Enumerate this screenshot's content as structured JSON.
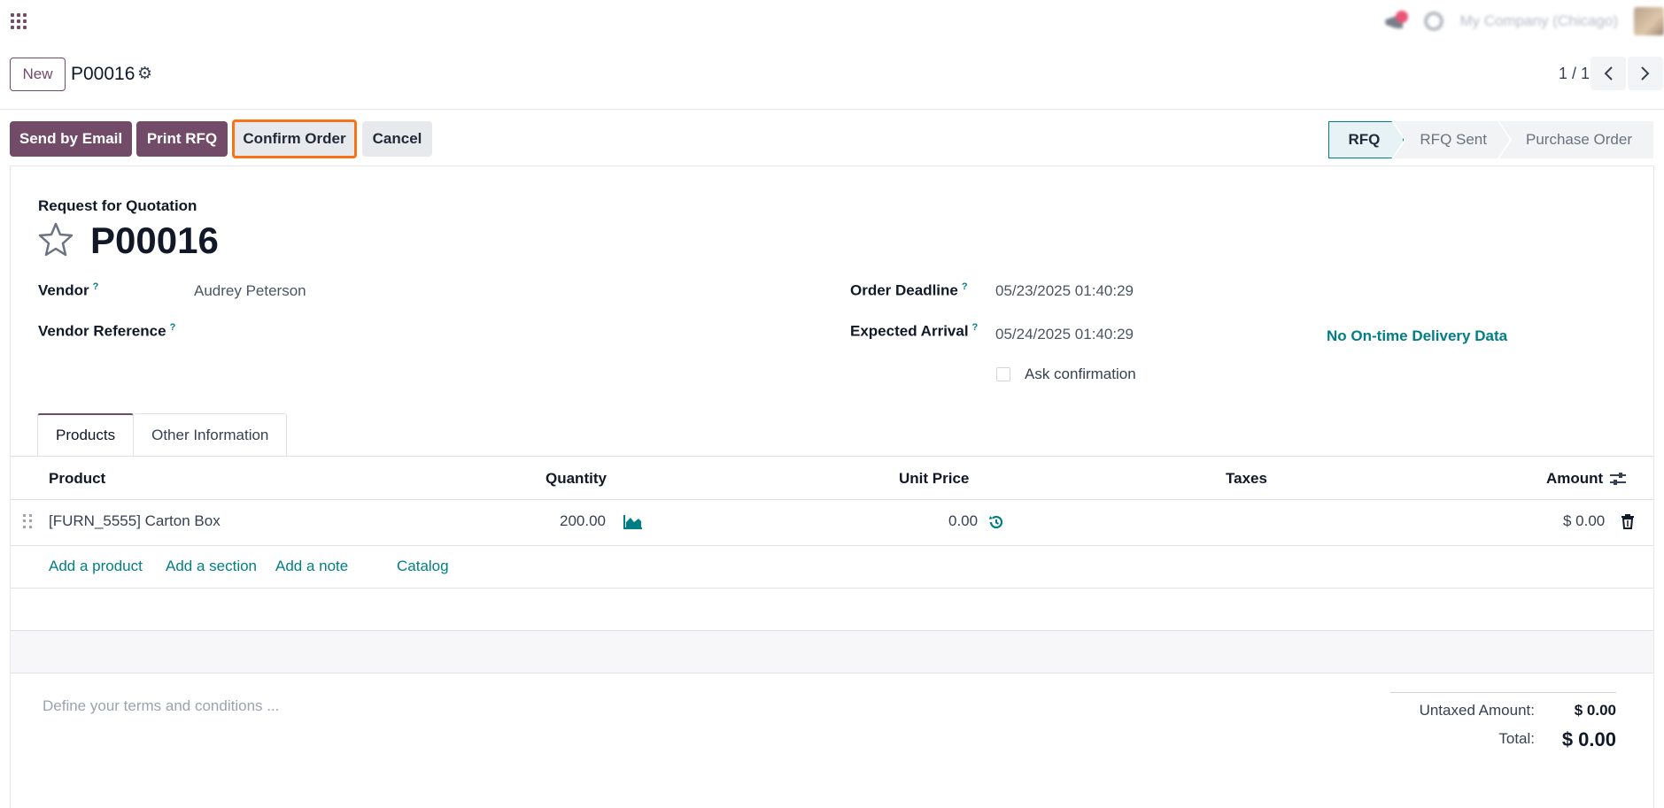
{
  "navbar": {
    "company": "My Company (Chicago)"
  },
  "control": {
    "new_label": "New",
    "record_name": "P00016",
    "pager": "1 / 1"
  },
  "actions": {
    "send_email": "Send by Email",
    "print_rfq": "Print RFQ",
    "confirm_order": "Confirm Order",
    "cancel": "Cancel"
  },
  "stages": [
    "RFQ",
    "RFQ Sent",
    "Purchase Order"
  ],
  "form": {
    "doc_type": "Request for Quotation",
    "name": "P00016",
    "vendor_label": "Vendor",
    "vendor_value": "Audrey Peterson",
    "vendor_ref_label": "Vendor Reference",
    "order_deadline_label": "Order Deadline",
    "order_deadline_value": "05/23/2025 01:40:29",
    "expected_arrival_label": "Expected Arrival",
    "expected_arrival_value": "05/24/2025 01:40:29",
    "ontime": "No On-time Delivery Data",
    "ask_confirmation": "Ask confirmation",
    "help_mark": "?"
  },
  "tabs": [
    "Products",
    "Other Information"
  ],
  "table": {
    "headers": {
      "product": "Product",
      "quantity": "Quantity",
      "unit_price": "Unit Price",
      "taxes": "Taxes",
      "amount": "Amount"
    },
    "rows": [
      {
        "product": "[FURN_5555] Carton Box",
        "quantity": "200.00",
        "unit_price": "0.00",
        "taxes": "",
        "amount": "$ 0.00"
      }
    ],
    "add_links": [
      "Add a product",
      "Add a section",
      "Add a note",
      "Catalog"
    ]
  },
  "footer": {
    "terms_placeholder": "Define your terms and conditions ...",
    "untaxed_label": "Untaxed Amount:",
    "untaxed_value": "$ 0.00",
    "total_label": "Total:",
    "total_value": "$ 0.00"
  },
  "colors": {
    "brand": "#714b67",
    "accent": "#017e84",
    "highlight": "#f97316"
  }
}
